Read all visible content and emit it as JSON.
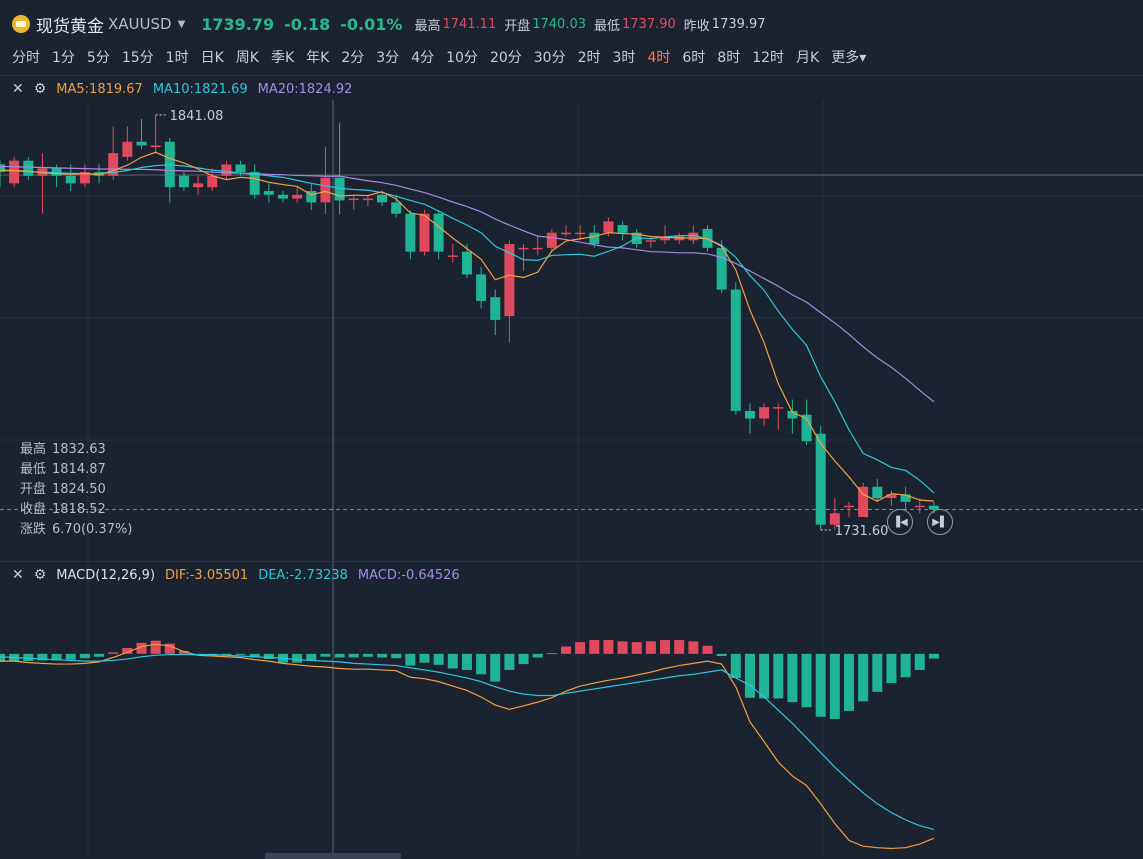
{
  "header": {
    "name": "现货黄金",
    "symbol": "XAUUSD",
    "price": "1739.79",
    "change": "-0.18",
    "change_pct": "-0.01%",
    "high_label": "最高",
    "high": "1741.11",
    "open_label": "开盘",
    "open": "1740.03",
    "low_label": "最低",
    "low": "1737.90",
    "prev_close_label": "昨收",
    "prev_close": "1739.97"
  },
  "timeframes": [
    "分时",
    "1分",
    "5分",
    "15分",
    "1时",
    "日K",
    "周K",
    "季K",
    "年K",
    "2分",
    "3分",
    "4分",
    "10分",
    "20分",
    "30分",
    "2时",
    "3时",
    "4时",
    "6时",
    "8时",
    "12时",
    "月K",
    "更多"
  ],
  "active_timeframe": "4时",
  "ma": {
    "ma5": "MA5:1819.67",
    "ma10": "MA10:1821.69",
    "ma20": "MA20:1824.92"
  },
  "macd": {
    "name": "MACD(12,26,9)",
    "dif": "DIF:-3.05501",
    "dea": "DEA:-2.73238",
    "macd": "MACD:-0.64526"
  },
  "ohlc_panel": {
    "high": {
      "label": "最高",
      "value": "1832.63"
    },
    "low": {
      "label": "最低",
      "value": "1814.87"
    },
    "open": {
      "label": "开盘",
      "value": "1824.50"
    },
    "close": {
      "label": "收盘",
      "value": "1818.52"
    },
    "change": {
      "label": "涨跌",
      "value": "6.70(0.37%)"
    }
  },
  "chart_data": {
    "type": "candlestick",
    "max_label": "1841.08",
    "min_label": "1731.60",
    "colors": {
      "up": "#e04a5c",
      "down": "#1fb594",
      "ma5": "#f0a044",
      "ma10": "#2ec6dd",
      "ma20": "#a58ae6",
      "dif": "#f0a044",
      "dea": "#2ec6dd"
    },
    "candles": [
      [
        1828,
        1826,
        1829,
        1822
      ],
      [
        1823,
        1829,
        1830,
        1822
      ],
      [
        1829,
        1825,
        1830,
        1824
      ],
      [
        1825,
        1827,
        1831,
        1815
      ],
      [
        1827,
        1825,
        1828,
        1822
      ],
      [
        1825,
        1823,
        1828,
        1821
      ],
      [
        1823,
        1826,
        1828,
        1822
      ],
      [
        1826,
        1825,
        1828,
        1823
      ],
      [
        1825,
        1831,
        1838,
        1824
      ],
      [
        1830,
        1834,
        1838,
        1829
      ],
      [
        1834,
        1833,
        1840,
        1832
      ],
      [
        1833,
        1833,
        1841.08,
        1831
      ],
      [
        1834,
        1822,
        1835,
        1818
      ],
      [
        1825,
        1822,
        1826,
        1821
      ],
      [
        1822,
        1823,
        1825,
        1820
      ],
      [
        1822,
        1825,
        1827,
        1821
      ],
      [
        1825,
        1828,
        1829,
        1824
      ],
      [
        1828,
        1826,
        1829,
        1825
      ],
      [
        1826,
        1820,
        1828,
        1819
      ],
      [
        1821,
        1820,
        1823,
        1818
      ],
      [
        1820,
        1819,
        1821,
        1818
      ],
      [
        1819,
        1820,
        1822,
        1818
      ],
      [
        1821,
        1818,
        1823,
        1816
      ],
      [
        1818,
        1824.5,
        1832.63,
        1814.87
      ],
      [
        1824.5,
        1818.52,
        1839,
        1814.87
      ],
      [
        1819,
        1819,
        1820,
        1816
      ],
      [
        1819,
        1819,
        1820,
        1817
      ],
      [
        1820,
        1818,
        1821,
        1817
      ],
      [
        1818,
        1815,
        1820,
        1814
      ],
      [
        1815,
        1805,
        1816,
        1803
      ],
      [
        1805,
        1815,
        1816,
        1804
      ],
      [
        1815,
        1805,
        1816,
        1803
      ],
      [
        1804,
        1804,
        1807,
        1802
      ],
      [
        1805,
        1799,
        1807,
        1798
      ],
      [
        1799,
        1792,
        1801,
        1790
      ],
      [
        1793,
        1787,
        1795,
        1783
      ],
      [
        1788,
        1807,
        1808,
        1781
      ],
      [
        1806,
        1806,
        1807,
        1800
      ],
      [
        1806,
        1806,
        1809,
        1804
      ],
      [
        1806,
        1810,
        1811,
        1805
      ],
      [
        1810,
        1810,
        1812,
        1809
      ],
      [
        1810,
        1810,
        1812,
        1808
      ],
      [
        1810,
        1807,
        1812,
        1806
      ],
      [
        1810,
        1813,
        1814,
        1809
      ],
      [
        1812,
        1810,
        1813,
        1808
      ],
      [
        1810,
        1807,
        1811,
        1806
      ],
      [
        1808,
        1808,
        1809,
        1806
      ],
      [
        1808,
        1809,
        1812,
        1807
      ],
      [
        1808,
        1809,
        1810,
        1807
      ],
      [
        1808,
        1810,
        1812,
        1807
      ],
      [
        1811,
        1806,
        1812,
        1805
      ],
      [
        1806,
        1795,
        1808,
        1794
      ],
      [
        1795,
        1763,
        1797,
        1762
      ],
      [
        1763,
        1761,
        1765,
        1757
      ],
      [
        1761,
        1764,
        1765,
        1759
      ],
      [
        1764,
        1764,
        1765,
        1758
      ],
      [
        1763,
        1761,
        1766,
        1757
      ],
      [
        1762,
        1755,
        1766,
        1754
      ],
      [
        1757,
        1733,
        1759,
        1731.6
      ],
      [
        1733,
        1736,
        1740,
        1731.6
      ],
      [
        1738,
        1738,
        1739,
        1735
      ],
      [
        1735,
        1743,
        1744,
        1736
      ],
      [
        1743,
        1740,
        1745,
        1739
      ],
      [
        1740,
        1741,
        1742,
        1738
      ],
      [
        1741,
        1739,
        1743,
        1737
      ],
      [
        1738,
        1738,
        1740,
        1736
      ],
      [
        1738,
        1737,
        1739,
        1736
      ]
    ],
    "ma5": [
      1826.5,
      1826.4,
      1826.2,
      1825.8,
      1825.6,
      1825.4,
      1825.6,
      1825.3,
      1826.4,
      1827.8,
      1829.9,
      1831.2,
      1829.6,
      1828.4,
      1826.8,
      1825.0,
      1824.0,
      1824.6,
      1824.3,
      1823.3,
      1822.7,
      1822.2,
      1820.0,
      1820.9,
      1819.67,
      1819.9,
      1819.8,
      1820.8,
      1818.9,
      1815.2,
      1814.6,
      1811.6,
      1808.6,
      1805.8,
      1803.0,
      1797.6,
      1798.8,
      1798.2,
      1799.6,
      1805.2,
      1807.8,
      1808.4,
      1809.0,
      1810.0,
      1809.8,
      1809.6,
      1809.0,
      1808.8,
      1808.6,
      1808.6,
      1808.4,
      1806.4,
      1800.2,
      1789.6,
      1781.0,
      1770.2,
      1762.6,
      1761.0,
      1754.4,
      1749.8,
      1745.6,
      1741.0,
      1739.2,
      1741.2,
      1740.8,
      1739.5,
      1739.2
    ],
    "ma10": [
      1826.4,
      1826.3,
      1826.1,
      1826.0,
      1825.8,
      1825.7,
      1825.6,
      1825.5,
      1825.9,
      1826.4,
      1827.2,
      1827.7,
      1827.9,
      1827.6,
      1827.1,
      1826.5,
      1826.2,
      1825.7,
      1825.4,
      1825.0,
      1824.6,
      1823.8,
      1823.0,
      1822.4,
      1821.69,
      1821.4,
      1821.2,
      1820.6,
      1819.6,
      1818.5,
      1817.5,
      1815.7,
      1813.8,
      1812.0,
      1810.0,
      1806.4,
      1804.7,
      1802.9,
      1802.7,
      1804.0,
      1804.2,
      1804.3,
      1803.8,
      1805.1,
      1806.5,
      1808.7,
      1808.4,
      1808.9,
      1809.2,
      1809.3,
      1808.4,
      1806.7,
      1803.5,
      1798.7,
      1794.8,
      1789.3,
      1784.5,
      1780.3,
      1772.0,
      1765.4,
      1758.0,
      1751.8,
      1750.1,
      1748.1,
      1747.3,
      1744.7,
      1741.4
    ],
    "ma20": [
      1827.5,
      1827.4,
      1827.3,
      1827.2,
      1827.1,
      1827.0,
      1826.9,
      1826.8,
      1826.8,
      1826.7,
      1826.7,
      1826.6,
      1826.4,
      1826.3,
      1826.2,
      1826.0,
      1825.8,
      1825.7,
      1825.6,
      1825.4,
      1825.3,
      1825.1,
      1825.0,
      1824.9,
      1824.92,
      1824.3,
      1823.7,
      1823.2,
      1822.5,
      1821.5,
      1820.6,
      1819.4,
      1818.1,
      1816.9,
      1815.5,
      1813.6,
      1812.0,
      1810.5,
      1809.1,
      1808.7,
      1808.2,
      1807.5,
      1806.8,
      1806.2,
      1806.0,
      1805.5,
      1805.0,
      1804.9,
      1804.7,
      1804.7,
      1804.4,
      1803.5,
      1801.9,
      1799.9,
      1797.9,
      1795.9,
      1793.6,
      1791.7,
      1788.9,
      1786.2,
      1783.2,
      1779.9,
      1777.0,
      1774.5,
      1771.6,
      1768.4,
      1765.4
    ],
    "macd_hist": [
      -1.1,
      -1.0,
      -1.0,
      -0.9,
      -0.9,
      -0.8,
      -0.6,
      -0.4,
      0.2,
      0.8,
      1.5,
      1.8,
      1.4,
      0.4,
      -0.2,
      -0.2,
      -0.2,
      -0.1,
      -0.5,
      -0.7,
      -1.2,
      -1.2,
      -0.9,
      -0.4,
      -0.5,
      -0.5,
      -0.4,
      -0.5,
      -0.6,
      -1.6,
      -1.2,
      -1.5,
      -2.0,
      -2.2,
      -2.8,
      -3.8,
      -2.2,
      -1.4,
      -0.5,
      0.1,
      1.0,
      1.6,
      1.9,
      1.9,
      1.7,
      1.6,
      1.7,
      1.9,
      1.9,
      1.7,
      1.1,
      -0.3,
      -3.3,
      -6.0,
      -6.1,
      -6.1,
      -6.6,
      -7.3,
      -8.6,
      -8.9,
      -7.8,
      -6.5,
      -5.2,
      -4.0,
      -3.2,
      -2.2,
      -0.65
    ],
    "dif": [
      -1.0,
      -1.0,
      -1.2,
      -1.3,
      -1.4,
      -1.4,
      -1.3,
      -1.1,
      -0.5,
      0.2,
      1.0,
      1.3,
      1.1,
      0.3,
      -0.2,
      -0.3,
      -0.4,
      -0.5,
      -0.8,
      -1.0,
      -1.3,
      -1.5,
      -1.7,
      -1.8,
      -2.0,
      -2.1,
      -2.1,
      -2.2,
      -2.3,
      -3.2,
      -3.4,
      -3.8,
      -4.4,
      -5.0,
      -5.9,
      -7.0,
      -7.6,
      -7.1,
      -6.6,
      -6.0,
      -5.1,
      -4.4,
      -4.0,
      -3.6,
      -3.3,
      -2.9,
      -2.5,
      -2.0,
      -1.6,
      -1.3,
      -1.0,
      -1.4,
      -4.5,
      -9.3,
      -12.0,
      -14.8,
      -16.7,
      -18.0,
      -20.5,
      -23.2,
      -25.5,
      -26.3,
      -26.5,
      -26.6,
      -26.5,
      -26.0,
      -25.2
    ],
    "dea": [
      -0.4,
      -0.5,
      -0.6,
      -0.7,
      -0.8,
      -0.9,
      -1.0,
      -1.0,
      -0.9,
      -0.7,
      -0.4,
      -0.2,
      -0.1,
      -0.1,
      -0.1,
      -0.1,
      -0.2,
      -0.3,
      -0.4,
      -0.5,
      -0.6,
      -0.8,
      -0.9,
      -1.0,
      -1.1,
      -1.3,
      -1.4,
      -1.5,
      -1.6,
      -1.9,
      -2.2,
      -2.5,
      -2.9,
      -3.3,
      -3.8,
      -4.5,
      -5.1,
      -5.5,
      -5.7,
      -5.7,
      -5.4,
      -5.1,
      -4.8,
      -4.5,
      -4.2,
      -3.9,
      -3.6,
      -3.3,
      -3.0,
      -2.8,
      -2.5,
      -2.2,
      -3.3,
      -4.3,
      -5.9,
      -7.7,
      -9.5,
      -11.5,
      -13.5,
      -15.5,
      -17.3,
      -19.0,
      -20.5,
      -21.7,
      -22.7,
      -23.5,
      -24.0
    ]
  }
}
